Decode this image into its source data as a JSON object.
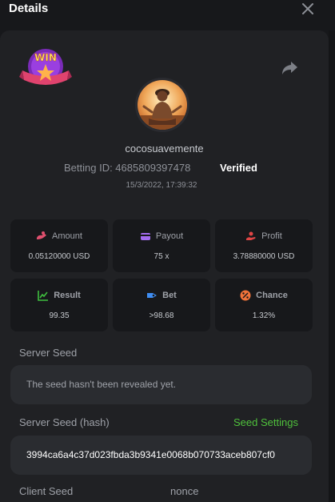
{
  "header": {
    "title": "Details",
    "close_icon": "close-icon"
  },
  "badge": {
    "text": "WIN"
  },
  "player": {
    "username": "cocosuavemente",
    "betting_id": "Betting ID: 4685809397478",
    "verified": "Verified",
    "timestamp": "15/3/2022, 17:39:32"
  },
  "stats": [
    {
      "label": "Amount",
      "value": "0.05120000 USD",
      "icon": "coins-icon",
      "color": "#e0506f"
    },
    {
      "label": "Payout",
      "value": "75 x",
      "icon": "wallet-icon",
      "color": "#a46cf0"
    },
    {
      "label": "Profit",
      "value": "3.78880000 USD",
      "icon": "hand-coin-icon",
      "color": "#e04545"
    },
    {
      "label": "Result",
      "value": "99.35",
      "icon": "trend-icon",
      "color": "#3fbf3f"
    },
    {
      "label": "Bet",
      "value": ">98.68",
      "icon": "tag-icon",
      "color": "#3f8df2"
    },
    {
      "label": "Chance",
      "value": "1.32%",
      "icon": "percent-icon",
      "color": "#f0733a"
    }
  ],
  "server_seed": {
    "label": "Server Seed",
    "value": "The seed hasn't been revealed yet."
  },
  "server_seed_hash": {
    "label": "Server Seed (hash)",
    "link": "Seed Settings",
    "value": "3994ca6a4c37d023fbda3b9341e0068b070733aceb807cf0"
  },
  "client_seed": {
    "label": "Client Seed"
  },
  "nonce": {
    "label": "nonce"
  }
}
